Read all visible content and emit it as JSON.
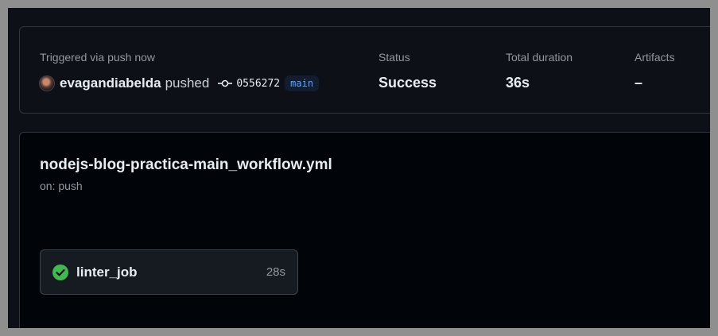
{
  "summary": {
    "trigger_label": "Triggered via push now",
    "username": "evagandiabelda",
    "action": "pushed",
    "commit_sha": "0556272",
    "branch": "main",
    "status_label": "Status",
    "status_value": "Success",
    "duration_label": "Total duration",
    "duration_value": "36s",
    "artifacts_label": "Artifacts",
    "artifacts_value": "–"
  },
  "workflow": {
    "file_name": "nodejs-blog-practica-main_workflow.yml",
    "trigger": "on: push",
    "jobs": [
      {
        "name": "linter_job",
        "duration": "28s",
        "status": "success",
        "icon": "check-circle-icon"
      }
    ]
  },
  "colors": {
    "success": "#3fb950",
    "branch_text": "#58a6ff",
    "background": "#0d1117"
  }
}
